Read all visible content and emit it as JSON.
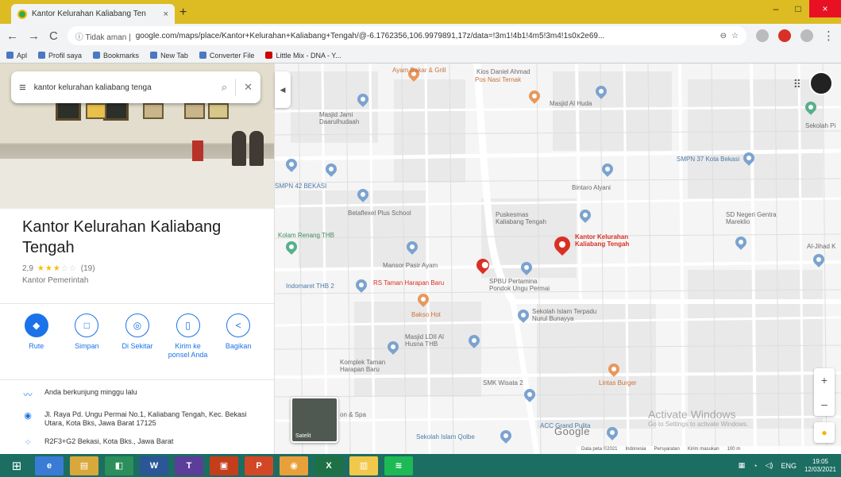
{
  "browser": {
    "tab_title": "Kantor Kelurahan Kaliabang Ten",
    "tab_close": "×",
    "new_tab": "+",
    "window_min": "–",
    "window_max": "□",
    "window_close": "×",
    "back": "←",
    "forward": "→",
    "reload": "C",
    "security": "ⓘ Tidak aman |",
    "url": "google.com/maps/place/Kantor+Kelurahan+Kaliabang+Tengah/@-6.1762356,106.9979891,17z/data=!3m1!4b1!4m5!3m4!1s0x2e69...",
    "bookmarks": [
      "Apl",
      "Profil saya",
      "Bookmarks",
      "New Tab",
      "Converter File",
      "Little Mix - DNA - Y..."
    ]
  },
  "panel": {
    "search_query": "kantor kelurahan kaliabang tenga",
    "place_name": "Kantor Kelurahan Kaliabang Tengah",
    "rating": "2,9",
    "stars_on": "★★★",
    "stars_off": "☆☆",
    "review_count": "(19)",
    "category": "Kantor Pemerintah",
    "actions": [
      {
        "label": "Rute",
        "icon": "◆"
      },
      {
        "label": "Simpan",
        "icon": "□"
      },
      {
        "label": "Di Sekitar",
        "icon": "◎"
      },
      {
        "label": "Kirim ke ponsel Anda",
        "icon": "▯"
      },
      {
        "label": "Bagikan",
        "icon": "<"
      }
    ],
    "details": [
      {
        "icon": "〰",
        "text": "Anda berkunjung minggu lalu"
      },
      {
        "icon": "◉",
        "text": "Jl. Raya Pd. Ungu Permai No.1, Kaliabang Tengah, Kec. Bekasi Utara, Kota Bks, Jawa Barat 17125"
      },
      {
        "icon": "⁘",
        "text": "R2F3+G2 Bekasi, Kota Bks., Jawa Barat"
      }
    ],
    "collapse": "◀"
  },
  "map": {
    "labels": [
      {
        "text": "Ayam Bakar & Grill",
        "cls": "orange"
      },
      {
        "text": "Kios Daniel Ahmad",
        "cls": ""
      },
      {
        "text": "Pos Nasi Ternak",
        "cls": "orange"
      },
      {
        "text": "Masjid Jami Daarulhudaah",
        "cls": ""
      },
      {
        "text": "Masjid Al Huda",
        "cls": ""
      },
      {
        "text": "Sekolah Pi",
        "cls": ""
      },
      {
        "text": "SMPN 42 BEKASI",
        "cls": "blue"
      },
      {
        "text": "SMPN 37 Kota Bekasi",
        "cls": "blue"
      },
      {
        "text": "Bintaro Alyani",
        "cls": ""
      },
      {
        "text": "Betaflexel Plus School",
        "cls": ""
      },
      {
        "text": "Puskesmas Kaliabang Tengah",
        "cls": ""
      },
      {
        "text": "SD Negeri Gentra Mareklio",
        "cls": ""
      },
      {
        "text": "Kolam Renang THB",
        "cls": "green"
      },
      {
        "text": "Kantor Kelurahan Kaliabang Tengah",
        "cls": "red"
      },
      {
        "text": "Al-Jihad K",
        "cls": ""
      },
      {
        "text": "Mansor Pasir Ayam",
        "cls": ""
      },
      {
        "text": "Indomaret THB 2",
        "cls": "blue"
      },
      {
        "text": "RS Taman Harapan Baru",
        "cls": "red"
      },
      {
        "text": "SPBU Pertamina Pondok Ungu Permai",
        "cls": ""
      },
      {
        "text": "Bakso Hot",
        "cls": "orange"
      },
      {
        "text": "Sekolah Islam Terpadu Nurul Bunayya",
        "cls": ""
      },
      {
        "text": "Masjid LDII Al Husna THB",
        "cls": ""
      },
      {
        "text": "Komplek Taman Harapan Baru",
        "cls": ""
      },
      {
        "text": "SMK Wisata 2",
        "cls": ""
      },
      {
        "text": "Lintas Burger",
        "cls": "orange"
      },
      {
        "text": "Sekolah Islam Qolbe",
        "cls": "blue"
      },
      {
        "text": "ACC Grand Pulita",
        "cls": "blue"
      },
      {
        "text": "on & Spa",
        "cls": ""
      }
    ],
    "satellite_label": "Satelit",
    "google": "Google",
    "activate_title": "Activate Windows",
    "activate_sub": "Go to Settings to activate Windows.",
    "footer": [
      "Data peta ©2021",
      "Indonesia",
      "Persyaratan",
      "Kirim masukan",
      "100 m"
    ],
    "zoom_in": "+",
    "zoom_out": "–",
    "apps_icon": "⠿"
  },
  "taskbar": {
    "apps": [
      {
        "label": "e",
        "color": "#3a7bd5"
      },
      {
        "label": "▤",
        "color": "#d9a83b"
      },
      {
        "label": "◧",
        "color": "#2a8f5a"
      },
      {
        "label": "W",
        "color": "#2b5797"
      },
      {
        "label": "T",
        "color": "#5b3e9a"
      },
      {
        "label": "▣",
        "color": "#c43e1c"
      },
      {
        "label": "P",
        "color": "#d24726"
      },
      {
        "label": "◉",
        "color": "#e8a13a"
      },
      {
        "label": "X",
        "color": "#1e7145"
      },
      {
        "label": "▥",
        "color": "#f2c84b"
      },
      {
        "label": "≋",
        "color": "#1db954"
      }
    ],
    "tray": "ENG",
    "time": "19:05",
    "date": "12/03/2021"
  }
}
